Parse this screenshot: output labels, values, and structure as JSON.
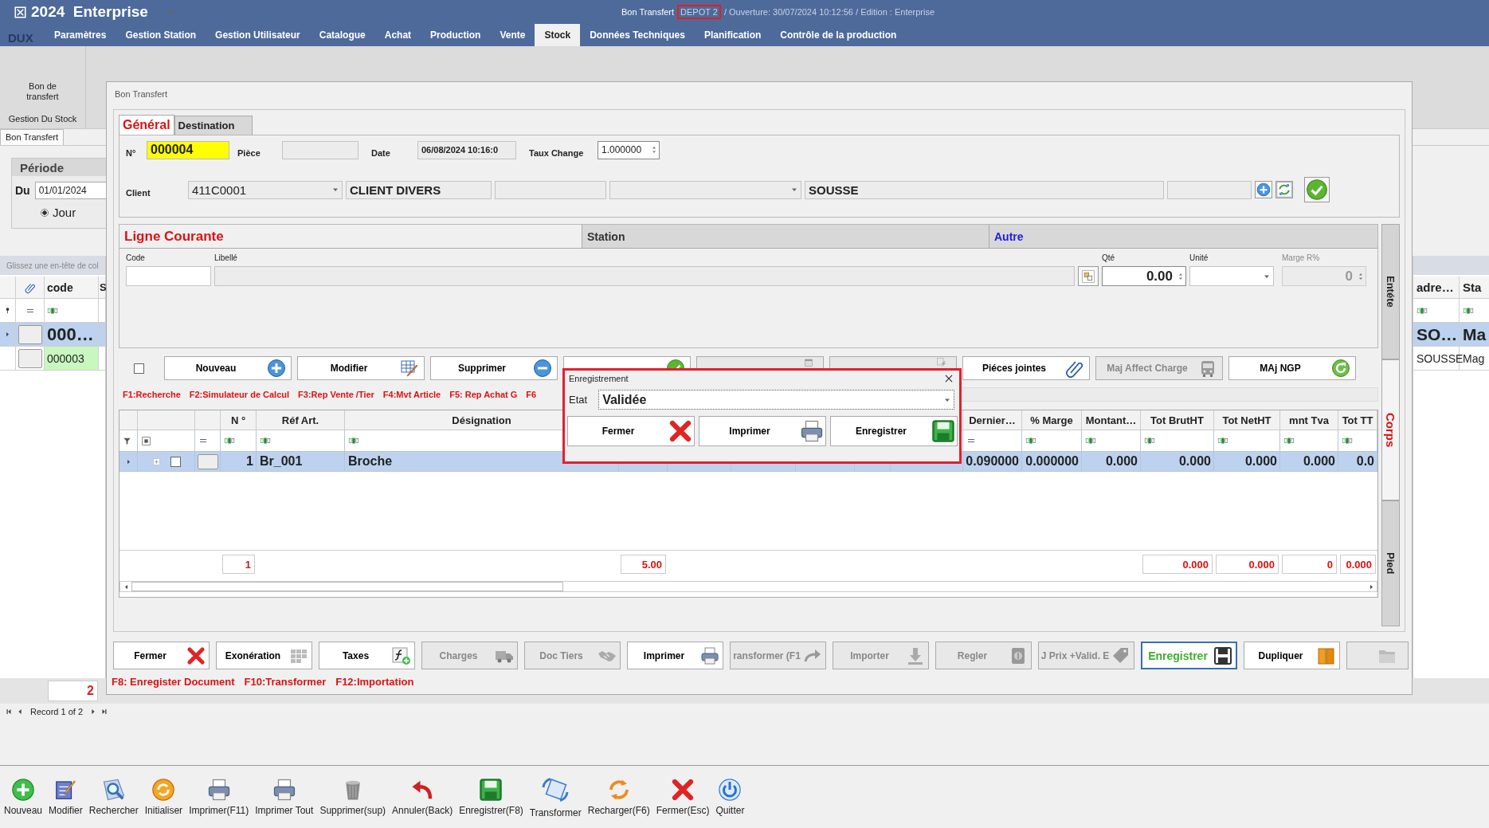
{
  "app": {
    "title": "2024  Enterprise",
    "document": "Bon Transfert",
    "depot": "DEPOT 2",
    "info": "/ Ouverture: 30/07/2024 10:12:56 / Edition : Enterprise"
  },
  "logo": "DUX",
  "menu": [
    {
      "label": "Paramètres",
      "selected": false
    },
    {
      "label": "Gestion Station",
      "selected": false
    },
    {
      "label": "Gestion Utilisateur",
      "selected": false
    },
    {
      "label": "Catalogue",
      "selected": false
    },
    {
      "label": "Achat",
      "selected": false
    },
    {
      "label": "Production",
      "selected": false
    },
    {
      "label": "Vente",
      "selected": false
    },
    {
      "label": "Stock",
      "selected": true
    },
    {
      "label": "Données Techniques",
      "selected": false
    },
    {
      "label": "Planification",
      "selected": false
    },
    {
      "label": "Contrôle de la production",
      "selected": false
    }
  ],
  "ribbon": {
    "button": "Bon de transfert",
    "group": "Gestion Du Stock"
  },
  "doc_tab": "Bon Transfert",
  "periode": {
    "title": "Période",
    "from_label": "Du",
    "from_value": "01/01/2024",
    "options": [
      {
        "label": "Jour",
        "selected": true
      }
    ]
  },
  "list": {
    "hint": "Glissez une en-tête de col",
    "columns": [
      "code",
      "S"
    ],
    "rows": [
      {
        "code": "000…",
        "selected": true
      },
      {
        "code": "000003",
        "selected": false,
        "color": "#c8f7c0"
      }
    ]
  },
  "right_list": {
    "columns": [
      "adre…",
      "Sta"
    ],
    "rows": [
      {
        "cells": [
          "SO…",
          "Ma"
        ],
        "selected": true
      },
      {
        "cells": [
          "SOUSSE",
          "Mag"
        ],
        "selected": false
      }
    ]
  },
  "list_footer": {
    "count": "2",
    "record": "Record 1 of 2"
  },
  "window": {
    "title": "Bon Transfert",
    "tabs": [
      {
        "label": "Général",
        "selected": true
      },
      {
        "label": "Destination",
        "selected": false
      }
    ],
    "header": {
      "numero_label": "N°",
      "numero": "000004",
      "piece_label": "Pièce",
      "date_label": "Date",
      "date": "06/08/2024 10:16:0",
      "taux_label": "Taux Change",
      "taux": "1.000000",
      "client_label": "Client",
      "client_code": "411C0001",
      "client_name": "CLIENT DIVERS",
      "city": "SOUSSE"
    },
    "ligne": {
      "sections": [
        {
          "label": "Ligne Courante",
          "kind": "title"
        },
        {
          "label": "Station",
          "kind": "plain"
        },
        {
          "label": "Autre",
          "kind": "link"
        }
      ],
      "code_label": "Code",
      "libelle_label": "Libellé",
      "qte_label": "Qté",
      "qte": "0.00",
      "unite_label": "Unité",
      "marge_label": "Marge R%",
      "marge": "0"
    },
    "side_tabs": [
      {
        "label": "Entéte",
        "selected": false
      },
      {
        "label": "Corps",
        "selected": true
      },
      {
        "label": "Pied",
        "selected": false
      }
    ],
    "line_checkbox": {
      "checked": false
    },
    "line_buttons": [
      {
        "label": "Nouveau",
        "disabled": false
      },
      {
        "label": "Modifier",
        "disabled": false
      },
      {
        "label": "Supprimer",
        "disabled": false
      },
      {
        "disabled": false
      },
      {
        "disabled": true
      },
      {
        "disabled": true
      },
      {
        "label": "Piéces jointes",
        "disabled": false
      },
      {
        "label": "Maj Affect Charge",
        "disabled": true
      },
      {
        "label": "MAj NGP",
        "disabled": false
      }
    ],
    "hotkeys": [
      "F1:Recherche",
      "F2:Simulateur de Calcul",
      "F3:Rep Vente /Tier",
      "F4:Mvt Article",
      "F5: Rep Achat G",
      "F6"
    ],
    "grid": {
      "row_selected": true,
      "columns": [
        {
          "kind": "indicator"
        },
        {
          "kind": "select",
          "checked": false
        },
        {
          "kind": "handle"
        },
        {
          "kind": "number",
          "header": "N °",
          "value": "1",
          "total": "1"
        },
        {
          "kind": "text",
          "header": "Réf Art.",
          "value": "Br_001"
        },
        {
          "kind": "text",
          "header": "Désignation",
          "value": "Broche"
        },
        {
          "kind": "number",
          "total": "5.00"
        },
        {
          "kind": "number"
        },
        {
          "kind": "number"
        },
        {
          "kind": "number"
        },
        {
          "kind": "number"
        },
        {
          "kind": "number"
        },
        {
          "kind": "number",
          "header": "Dernier…",
          "value": "0.090000"
        },
        {
          "kind": "number",
          "header": "% Marge",
          "value": "0.000000"
        },
        {
          "kind": "number",
          "header": "Montant…",
          "value": "0.000"
        },
        {
          "kind": "number",
          "header": "Tot BrutHT",
          "value": "0.000",
          "total": "0.000"
        },
        {
          "kind": "number",
          "header": "Tot NetHT",
          "value": "0.000",
          "total": "0.000"
        },
        {
          "kind": "number",
          "header": "mnt Tva",
          "value": "0.000",
          "total": "0"
        },
        {
          "kind": "number",
          "header": "Tot TT",
          "value": "0.0",
          "total": "0.000"
        }
      ]
    },
    "footer_buttons": [
      {
        "label": "Fermer",
        "disabled": false,
        "focused": false
      },
      {
        "label": "Exonération",
        "disabled": false,
        "focused": false
      },
      {
        "label": "Taxes",
        "disabled": false,
        "focused": false
      },
      {
        "label": "Charges",
        "disabled": true,
        "focused": false
      },
      {
        "label": "Doc Tiers",
        "disabled": true,
        "focused": false
      },
      {
        "label": "Imprimer",
        "disabled": false,
        "focused": false
      },
      {
        "label": "ransformer (F1",
        "disabled": true,
        "focused": false
      },
      {
        "label": "Importer",
        "disabled": true,
        "focused": false
      },
      {
        "label": "Regler",
        "disabled": true,
        "focused": false
      },
      {
        "label": "J Prix +Valid. E",
        "disabled": true,
        "focused": false
      },
      {
        "label": "Enregistrer",
        "disabled": false,
        "focused": true
      },
      {
        "label": "Dupliquer",
        "disabled": false,
        "focused": false
      },
      {
        "disabled": true,
        "focused": false
      }
    ],
    "footer_hotkeys": [
      "F8: Enregister Document",
      "F10:Transformer",
      "F12:Importation"
    ]
  },
  "popup": {
    "title": "Enregistrement",
    "etat_label": "Etat",
    "etat": "Validée",
    "buttons": [
      "Fermer",
      "Imprimer",
      "Enregistrer"
    ]
  },
  "toolbar": [
    {
      "label": "Nouveau"
    },
    {
      "label": "Modifier"
    },
    {
      "label": "Rechercher"
    },
    {
      "label": "Initialiser"
    },
    {
      "label": "Imprimer(F11)"
    },
    {
      "label": "Imprimer Tout"
    },
    {
      "label": "Supprimer(sup)"
    },
    {
      "label": "Annuler(Back)"
    },
    {
      "label": "Enregistrer(F8)"
    },
    {
      "label": "Transformer"
    },
    {
      "label": "Recharger(F6)"
    },
    {
      "label": "Fermer(Esc)"
    },
    {
      "label": "Quitter"
    }
  ]
}
